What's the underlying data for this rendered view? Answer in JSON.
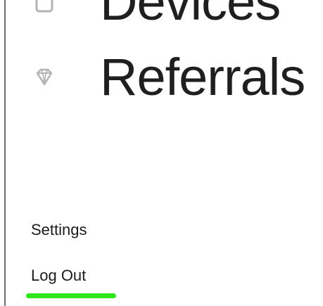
{
  "nav": {
    "items": [
      {
        "label": "Devices",
        "icon": "device-icon"
      },
      {
        "label": "Referrals",
        "icon": "diamond-icon"
      }
    ]
  },
  "footer": {
    "settings_label": "Settings",
    "logout_label": "Log Out"
  },
  "colors": {
    "text": "#1f1f1f",
    "icon": "#b3b3b3",
    "active_underline": "#2ee619",
    "divider": "#6e6e6e"
  }
}
